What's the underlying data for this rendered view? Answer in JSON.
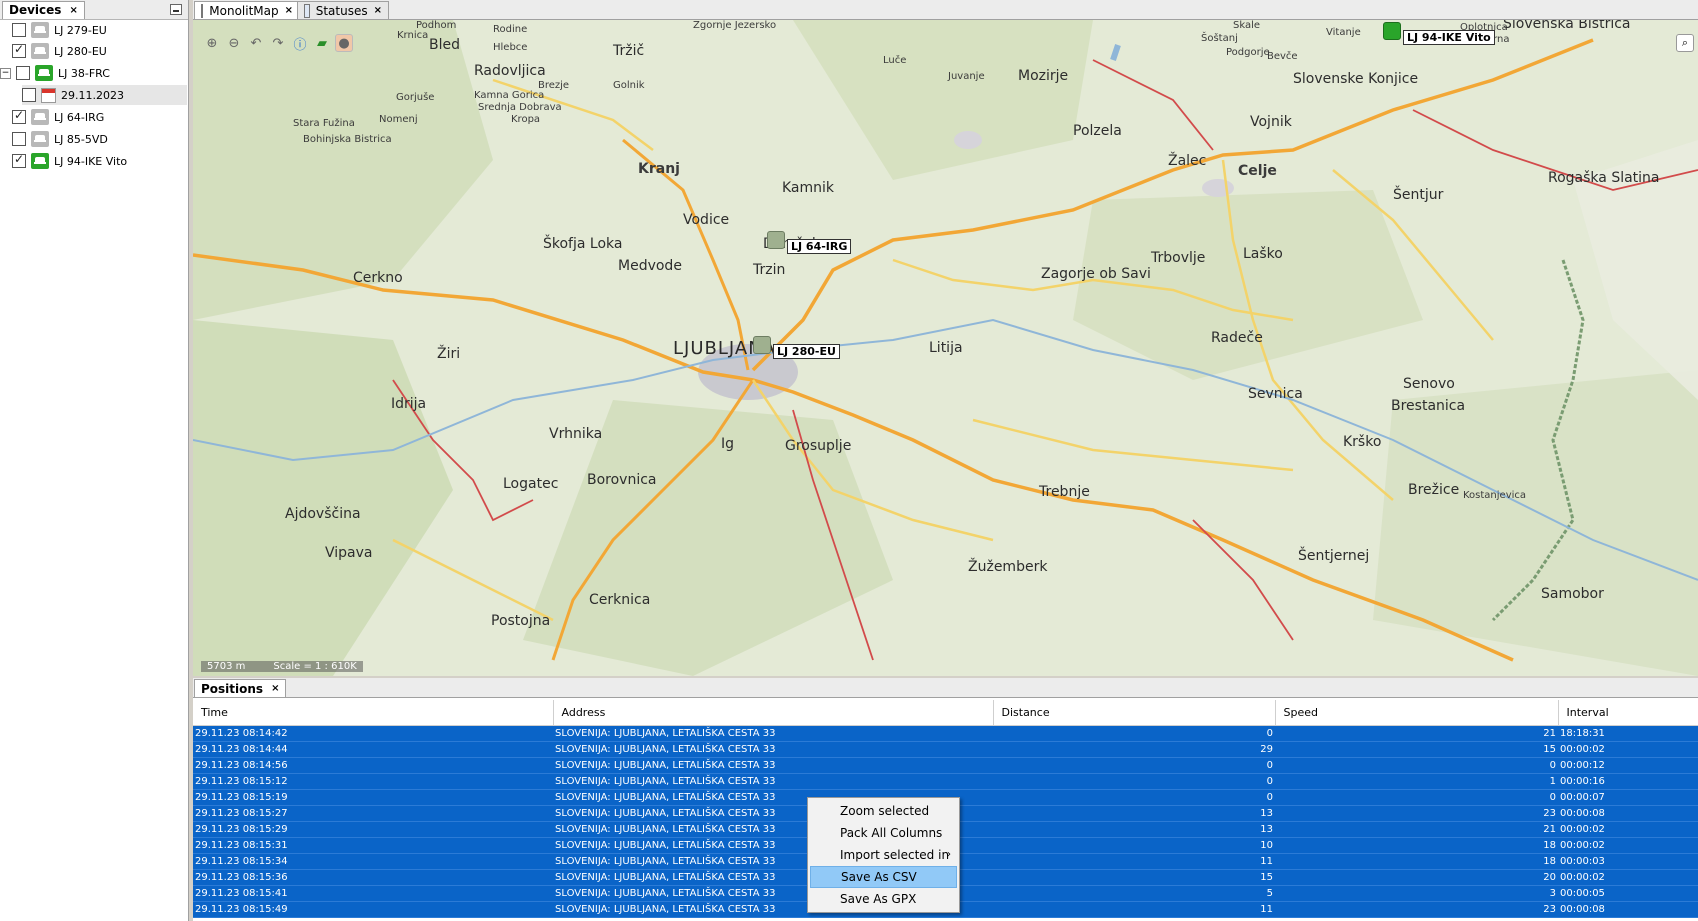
{
  "devices_panel": {
    "title": "Devices",
    "close": "×",
    "items": [
      {
        "label": "LJ 279-EU",
        "checked": false,
        "icon": "car-icon-grey"
      },
      {
        "label": "LJ 280-EU",
        "checked": true,
        "icon": "car-icon-grey"
      },
      {
        "label": "LJ 38-FRC",
        "checked": false,
        "icon": "car-icon-green",
        "expander": "−"
      },
      {
        "label": "29.11.2023",
        "checked": false,
        "icon": "calendar-icon"
      },
      {
        "label": "LJ 64-IRG",
        "checked": true,
        "icon": "car-icon-grey"
      },
      {
        "label": "LJ 85-5VD",
        "checked": false,
        "icon": "car-icon-grey"
      },
      {
        "label": "LJ 94-IKE Vito",
        "checked": true,
        "icon": "car-icon-green"
      }
    ]
  },
  "tabs": [
    {
      "label": "MonolitMap",
      "close": "×",
      "active": true
    },
    {
      "label": "Statuses",
      "close": "×",
      "active": false
    }
  ],
  "map": {
    "toolbar": [
      "zoom-in-icon",
      "zoom-out-icon",
      "undo-icon",
      "redo-icon",
      "info-icon",
      "layer-icon",
      "map-style-icon"
    ],
    "scale": {
      "distance": "5703 m",
      "ratio": "Scale = 1 : 610K"
    },
    "markers": [
      {
        "label": "LJ 64-IRG",
        "color": "grey"
      },
      {
        "label": "LJ 280-EU",
        "color": "grey"
      },
      {
        "label": "LJ 94-IKE Vito",
        "color": "green"
      }
    ],
    "places": [
      "Podhom",
      "Krnica",
      "Rodine",
      "Bled",
      "Hlebce",
      "Tržič",
      "Zgornje Jezersko",
      "Šoštanj",
      "Škale",
      "Podgorje",
      "Bevče",
      "Vitanje",
      "Oplotnica",
      "Malahorna",
      "Slovenska Bistrica",
      "Radovljica",
      "Kamna Gorica",
      "Srednja Dobrava",
      "Brezje",
      "Golnik",
      "Mozirje",
      "Juvanje",
      "Luče",
      "Slovenske Konjice",
      "Gorjuše",
      "Stara Fužina",
      "Bohinjska Bistrica",
      "Nomenj",
      "Kropa",
      "Kranj",
      "Kamnik",
      "Polzela",
      "Žalec",
      "Celje",
      "Vojnik",
      "Šentjur",
      "Rogaška Slatina",
      "Vodice",
      "Škofja Loka",
      "Medvode",
      "Trzin",
      "Domžale",
      "Cerkno",
      "Trbovlje",
      "Zagorje ob Savi",
      "Laško",
      "LJUBLJANA",
      "Litija",
      "Radeče",
      "Sevnica",
      "Idrija",
      "Žiri",
      "Vrhnika",
      "Logatec",
      "Borovnica",
      "Ig",
      "Grosuplje",
      "Trebnje",
      "Krško",
      "Brežice",
      "Ajdovščina",
      "Vipava",
      "Cerknica",
      "Postojna",
      "Žužemberk",
      "Šentjernej",
      "Samobor",
      "Senovo",
      "Brestanica",
      "Kostanjevica"
    ]
  },
  "positions": {
    "title": "Positions",
    "close": "×",
    "columns": [
      "Time",
      "Address",
      "Distance",
      "Speed",
      "Interval"
    ],
    "rows": [
      [
        "29.11.23 08:14:42",
        "SLOVENIJA: LJUBLJANA, LETALIŠKA CESTA 33",
        "0",
        "21",
        "18:18:31"
      ],
      [
        "29.11.23 08:14:44",
        "SLOVENIJA: LJUBLJANA, LETALIŠKA CESTA 33",
        "29",
        "15",
        "00:00:02"
      ],
      [
        "29.11.23 08:14:56",
        "SLOVENIJA: LJUBLJANA, LETALIŠKA CESTA 33",
        "0",
        "0",
        "00:00:12"
      ],
      [
        "29.11.23 08:15:12",
        "SLOVENIJA: LJUBLJANA, LETALIŠKA CESTA 33",
        "0",
        "1",
        "00:00:16"
      ],
      [
        "29.11.23 08:15:19",
        "SLOVENIJA: LJUBLJANA, LETALIŠKA CESTA 33",
        "0",
        "0",
        "00:00:07"
      ],
      [
        "29.11.23 08:15:27",
        "SLOVENIJA: LJUBLJANA, LETALIŠKA CESTA 33",
        "13",
        "23",
        "00:00:08"
      ],
      [
        "29.11.23 08:15:29",
        "SLOVENIJA: LJUBLJANA, LETALIŠKA CESTA 33",
        "13",
        "21",
        "00:00:02"
      ],
      [
        "29.11.23 08:15:31",
        "SLOVENIJA: LJUBLJANA, LETALIŠKA CESTA 33",
        "10",
        "18",
        "00:00:02"
      ],
      [
        "29.11.23 08:15:34",
        "SLOVENIJA: LJUBLJANA, LETALIŠKA CESTA 33",
        "11",
        "18",
        "00:00:03"
      ],
      [
        "29.11.23 08:15:36",
        "SLOVENIJA: LJUBLJANA, LETALIŠKA CESTA 33",
        "15",
        "20",
        "00:00:02"
      ],
      [
        "29.11.23 08:15:41",
        "SLOVENIJA: LJUBLJANA, LETALIŠKA CESTA 33",
        "5",
        "3",
        "00:00:05"
      ],
      [
        "29.11.23 08:15:49",
        "SLOVENIJA: LJUBLJANA, LETALIŠKA CESTA 33",
        "11",
        "23",
        "00:00:08"
      ]
    ]
  },
  "context_menu": {
    "items": [
      {
        "label": "Zoom selected",
        "highlighted": false
      },
      {
        "label": "Pack All Columns",
        "highlighted": false
      },
      {
        "label": "Import selected in",
        "highlighted": false,
        "submenu": "›"
      },
      {
        "label": "Save As CSV",
        "highlighted": true
      },
      {
        "label": "Save As GPX",
        "highlighted": false
      }
    ]
  },
  "colors": {
    "selection": "#0a64c8",
    "menu_highlight": "#91c9f7",
    "vehicle_active": "#2aa52a"
  }
}
